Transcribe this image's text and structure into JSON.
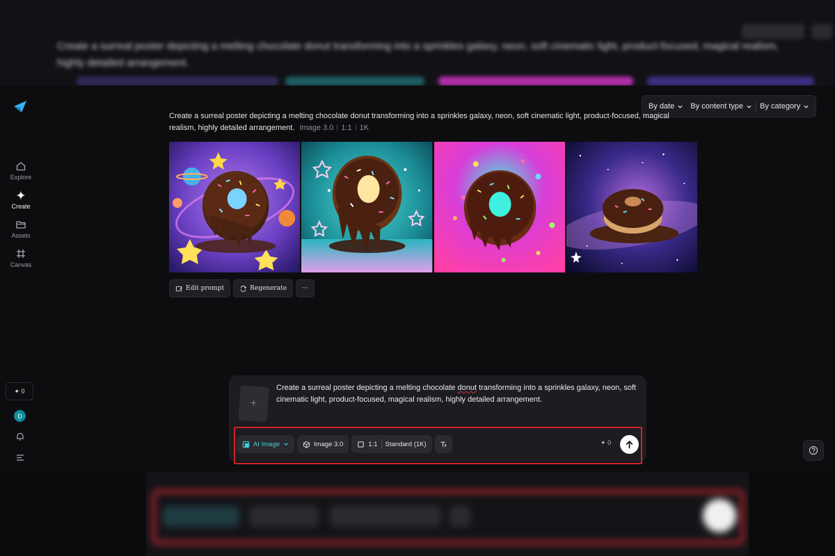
{
  "background": {
    "top_prompt": "Create a surreal poster depicting a melting chocolate donut transforming into a sprinkles galaxy, neon, soft cinematic light, product-focused, magical realism,",
    "top_prompt_cont": "highly detailed arrangement."
  },
  "sidebar": {
    "items": [
      {
        "label": "Explore",
        "icon": "home-icon"
      },
      {
        "label": "Create",
        "icon": "sparkle-icon"
      },
      {
        "label": "Assets",
        "icon": "folder-icon"
      },
      {
        "label": "Canvas",
        "icon": "canvas-icon"
      }
    ],
    "credits": "0",
    "avatar_initial": "D"
  },
  "filters": {
    "by_date": "By date",
    "by_content_type": "By content type",
    "by_category": "By category"
  },
  "generation": {
    "prompt": "Create a surreal poster depicting a melting chocolate donut transforming into a sprinkles galaxy, neon, soft cinematic light, product-focused, magical realism, highly detailed arrangement.",
    "model": "Image 3.0",
    "ratio": "1:1",
    "resolution": "1K",
    "images": [
      {
        "name": "donut-purple-galaxy"
      },
      {
        "name": "donut-teal-stars"
      },
      {
        "name": "donut-pink-neon"
      },
      {
        "name": "donut-space-galaxy"
      }
    ],
    "actions": {
      "edit": "Edit prompt",
      "regenerate": "Regenerate",
      "more": "···"
    }
  },
  "composer": {
    "upload_symbol": "+",
    "prompt_before": "Create a surreal poster depicting a melting chocolate ",
    "prompt_misspelled": "donut",
    "prompt_after": " transforming into a sprinkles galaxy, neon, soft cinematic light, product-focused, magical realism, highly detailed arrangement.",
    "mode": "AI Image",
    "model": "Image 3.0",
    "ratio": "1:1",
    "quality": "Standard (1K)",
    "cost": "0"
  },
  "colors": {
    "accent": "#3fd0d6",
    "highlight_frame": "#d2232a",
    "avatar": "#0e8f9a"
  }
}
